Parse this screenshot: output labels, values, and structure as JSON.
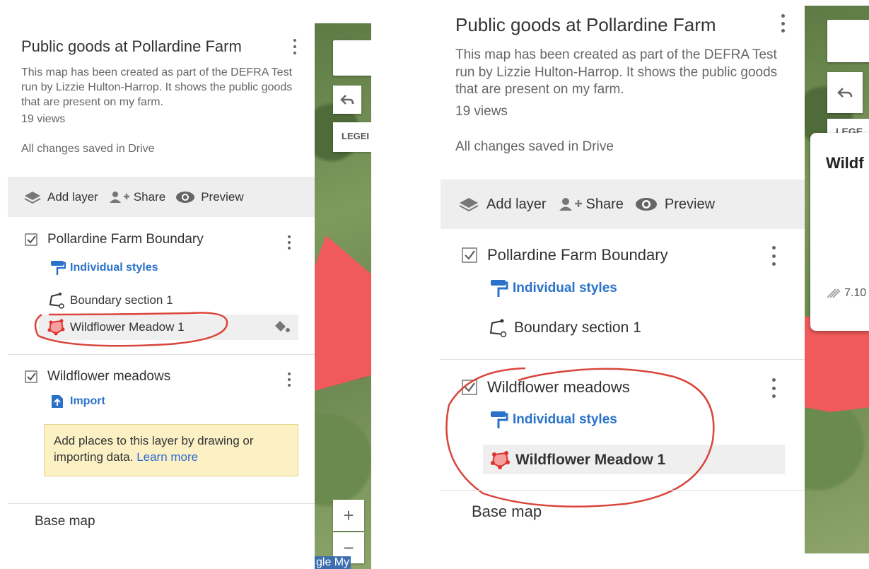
{
  "left": {
    "title": "Public goods at Pollardine Farm",
    "description": "This map has been created as part of the DEFRA Test run by Lizzie Hulton-Harrop. It shows the public goods that are present on my farm.",
    "views": "19 views",
    "saved_status": "All changes saved in Drive",
    "toolbar": {
      "add_layer": "Add layer",
      "share": "Share",
      "preview": "Preview"
    },
    "layer1": {
      "name": "Pollardine Farm Boundary",
      "style_link": "Individual styles",
      "features": [
        "Boundary section 1",
        "Wildflower Meadow 1"
      ]
    },
    "layer2": {
      "name": "Wildflower meadows",
      "import_link": "Import",
      "tip_text": "Add places to this layer by drawing or importing data.",
      "tip_link": "Learn more"
    },
    "base_map": "Base map",
    "map": {
      "legend": "LEGEI",
      "zoom_in": "+",
      "zoom_out": "−",
      "attribution": "gle My"
    }
  },
  "right": {
    "title": "Public goods at Pollardine Farm",
    "description": "This map has been created as part of the DEFRA Test run by Lizzie Hulton-Harrop. It shows the public goods that are present on my farm.",
    "views": "19 views",
    "saved_status": "All changes saved in Drive",
    "toolbar": {
      "add_layer": "Add layer",
      "share": "Share",
      "preview": "Preview"
    },
    "layer1": {
      "name": "Pollardine Farm Boundary",
      "style_link": "Individual styles",
      "features": [
        "Boundary section 1"
      ]
    },
    "layer2": {
      "name": "Wildflower meadows",
      "style_link": "Individual styles",
      "features": [
        "Wildflower Meadow 1"
      ]
    },
    "base_map": "Base map",
    "map": {
      "legend": "LEGE",
      "popup_title": "Wildf",
      "popup_area": "7.10"
    }
  },
  "colors": {
    "accent": "#2a72c9",
    "polygon": "#f05a5a",
    "annotation": "#d9453b"
  }
}
